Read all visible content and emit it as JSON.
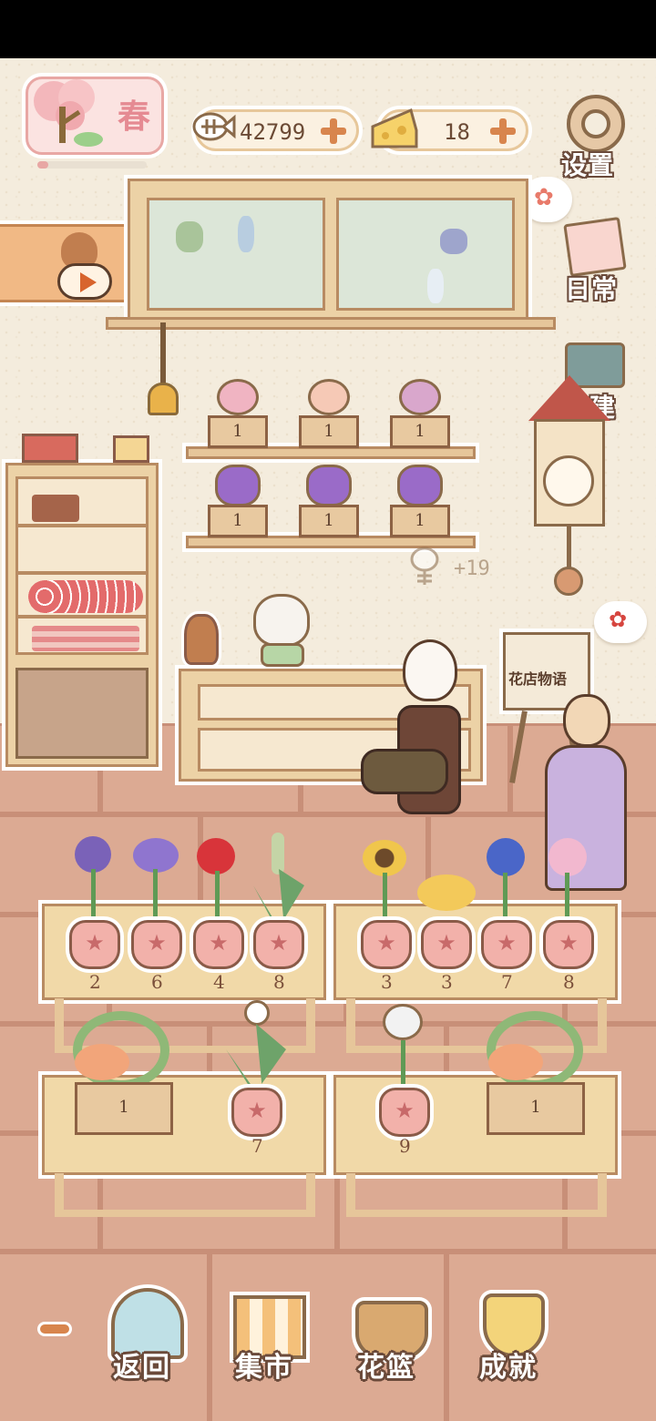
{
  "season": {
    "label": "春"
  },
  "currency": {
    "fish_bones": "42799",
    "cheese": "18"
  },
  "side_menu": {
    "settings": "设置",
    "daily": "日常",
    "expand": "扩建"
  },
  "crate_label": "1",
  "shop_sign": "花店物语",
  "fish_reward": "+19",
  "pot_numbers": {
    "p1": "2",
    "p2": "6",
    "p3": "4",
    "p4": "8",
    "p5": "3",
    "p6": "3",
    "p7": "7",
    "p8": "8",
    "p9": "7",
    "p10": "9"
  },
  "bottom_nav": {
    "back": "返回",
    "market": "集市",
    "basket": "花篮",
    "achievements": "成就"
  },
  "colors": {
    "accent": "#d8854d",
    "wall": "#f4ecdd",
    "floor": "#d9a58d",
    "wood": "#ecd2a6"
  }
}
